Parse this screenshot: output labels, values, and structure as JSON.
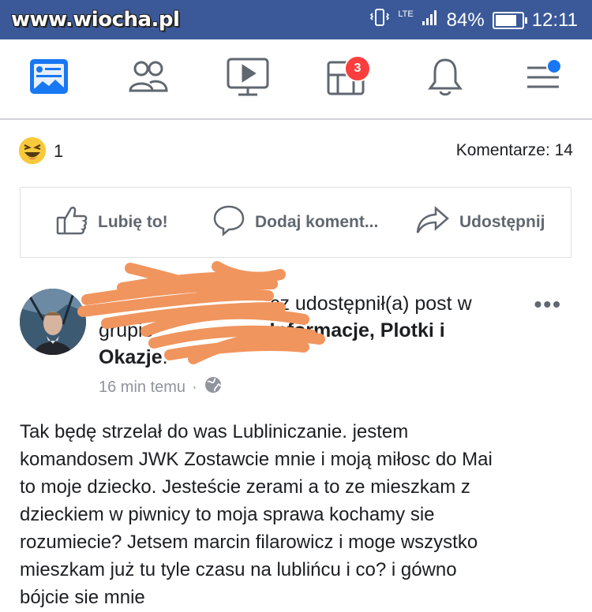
{
  "status_bar": {
    "watermark": "www.wiocha.pl",
    "network": "LTE",
    "battery": "84%",
    "battery_level": 0.84,
    "time": "12:11",
    "background_color": "#3b5998"
  },
  "nav": {
    "items": [
      {
        "name": "news-feed-icon"
      },
      {
        "name": "friends-icon"
      },
      {
        "name": "watch-icon"
      },
      {
        "name": "groups-icon",
        "badge": "3"
      },
      {
        "name": "notifications-bell-icon"
      },
      {
        "name": "menu-icon"
      }
    ]
  },
  "reactions": {
    "count": "1",
    "comments": "Komentarze: 14"
  },
  "actions": {
    "like": "Lubię to!",
    "comment": "Dodaj koment...",
    "share": "Udostępnij"
  },
  "post": {
    "header_visible_1": "cz udostępnił(a) post w",
    "header_prefix_2": "grupie",
    "group_name_part1": "Informacje, Plotki i",
    "group_name_part2": "Okazje",
    "period": ".",
    "time": "16 min temu",
    "separator": "·",
    "more": "•••",
    "body_lines": [
      "Tak będę strzelał do was Lubliniczanie. jestem",
      "komandosem JWK  Zostawcie mnie i moją miłosc do Mai",
      "to moje dziecko. Jesteście zerami a to ze mieszkam z",
      "dzieckiem w piwnicy to moja sprawa kochamy sie",
      "rozumiecie? Jetsem marcin filarowicz i moge wszystko",
      "mieszkam już tu tyle czasu na lublińcu i co? i gówno",
      "bójcie sie mnie"
    ]
  },
  "colors": {
    "facebook_blue": "#1877f2",
    "badge_red": "#fa3e3e",
    "redaction_orange": "#f0955e"
  }
}
